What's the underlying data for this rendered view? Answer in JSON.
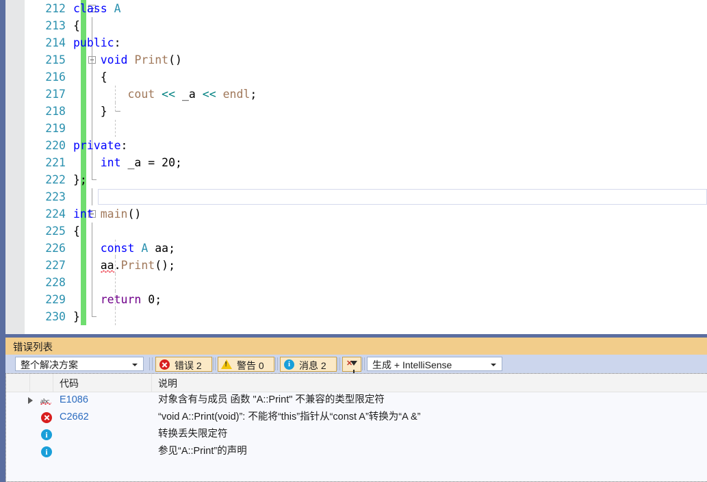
{
  "editor": {
    "lines": [
      {
        "num": "212",
        "indent": 0,
        "glyph": true,
        "text": "class A",
        "tokens": [
          {
            "t": "class",
            "c": "kw"
          },
          {
            "t": " ",
            "c": "idn"
          },
          {
            "t": "A",
            "c": "typ"
          }
        ]
      },
      {
        "num": "213",
        "indent": 0,
        "glyph": false,
        "text": "{",
        "tokens": [
          {
            "t": "{",
            "c": "idn"
          }
        ]
      },
      {
        "num": "214",
        "indent": 0,
        "glyph": false,
        "text": "public:",
        "tokens": [
          {
            "t": "public",
            "c": "kw"
          },
          {
            "t": ":",
            "c": "idn"
          }
        ]
      },
      {
        "num": "215",
        "indent": 0,
        "glyph": true,
        "text": "    void Print()",
        "tokens": [
          {
            "t": "    ",
            "c": "idn"
          },
          {
            "t": "void",
            "c": "kw"
          },
          {
            "t": " ",
            "c": "idn"
          },
          {
            "t": "Print",
            "c": "fn"
          },
          {
            "t": "()",
            "c": "idn"
          }
        ]
      },
      {
        "num": "216",
        "indent": 0,
        "glyph": false,
        "text": "    {",
        "tokens": [
          {
            "t": "    {",
            "c": "idn"
          }
        ]
      },
      {
        "num": "217",
        "indent": 0,
        "glyph": false,
        "text": "        cout << _a << endl;",
        "tokens": [
          {
            "t": "        ",
            "c": "idn"
          },
          {
            "t": "cout",
            "c": "fn"
          },
          {
            "t": " ",
            "c": "idn"
          },
          {
            "t": "<<",
            "c": "op"
          },
          {
            "t": " _a ",
            "c": "idn"
          },
          {
            "t": "<<",
            "c": "op"
          },
          {
            "t": " ",
            "c": "idn"
          },
          {
            "t": "endl",
            "c": "fn"
          },
          {
            "t": ";",
            "c": "idn"
          }
        ]
      },
      {
        "num": "218",
        "indent": 0,
        "glyph": false,
        "text": "    }",
        "tokens": [
          {
            "t": "    }",
            "c": "idn"
          }
        ]
      },
      {
        "num": "219",
        "indent": 0,
        "glyph": false,
        "text": "",
        "tokens": []
      },
      {
        "num": "220",
        "indent": 0,
        "glyph": false,
        "text": "private:",
        "tokens": [
          {
            "t": "private",
            "c": "kw"
          },
          {
            "t": ":",
            "c": "idn"
          }
        ]
      },
      {
        "num": "221",
        "indent": 0,
        "glyph": false,
        "text": "    int _a = 20;",
        "tokens": [
          {
            "t": "    ",
            "c": "idn"
          },
          {
            "t": "int",
            "c": "kw"
          },
          {
            "t": " _a = ",
            "c": "idn"
          },
          {
            "t": "20",
            "c": "num"
          },
          {
            "t": ";",
            "c": "idn"
          }
        ]
      },
      {
        "num": "222",
        "indent": 0,
        "glyph": false,
        "text": "};",
        "tokens": [
          {
            "t": "};",
            "c": "idn"
          }
        ]
      },
      {
        "num": "223",
        "indent": 0,
        "glyph": false,
        "text": "",
        "tokens": []
      },
      {
        "num": "224",
        "indent": 0,
        "glyph": true,
        "text": "int main()",
        "tokens": [
          {
            "t": "int",
            "c": "kw"
          },
          {
            "t": " ",
            "c": "idn"
          },
          {
            "t": "main",
            "c": "fn"
          },
          {
            "t": "()",
            "c": "idn"
          }
        ]
      },
      {
        "num": "225",
        "indent": 0,
        "glyph": false,
        "text": "{",
        "tokens": [
          {
            "t": "{",
            "c": "idn"
          }
        ]
      },
      {
        "num": "226",
        "indent": 0,
        "glyph": false,
        "text": "    const A aa;",
        "tokens": [
          {
            "t": "    ",
            "c": "idn"
          },
          {
            "t": "const",
            "c": "kw"
          },
          {
            "t": " ",
            "c": "idn"
          },
          {
            "t": "A",
            "c": "typ"
          },
          {
            "t": " aa;",
            "c": "idn"
          }
        ]
      },
      {
        "num": "227",
        "indent": 0,
        "glyph": false,
        "text": "    aa.Print();",
        "tokens": [
          {
            "t": "    ",
            "c": "idn"
          },
          {
            "t": "aa",
            "c": "idn",
            "squiggle": true
          },
          {
            "t": ".",
            "c": "idn"
          },
          {
            "t": "Print",
            "c": "fn"
          },
          {
            "t": "();",
            "c": "idn"
          }
        ]
      },
      {
        "num": "228",
        "indent": 0,
        "glyph": false,
        "text": "",
        "tokens": []
      },
      {
        "num": "229",
        "indent": 0,
        "glyph": false,
        "text": "    return 0;",
        "tokens": [
          {
            "t": "    ",
            "c": "idn"
          },
          {
            "t": "return",
            "c": "ppl"
          },
          {
            "t": " ",
            "c": "idn"
          },
          {
            "t": "0",
            "c": "num"
          },
          {
            "t": ";",
            "c": "idn"
          }
        ]
      },
      {
        "num": "230",
        "indent": 0,
        "glyph": false,
        "text": "}",
        "tokens": [
          {
            "t": "}",
            "c": "idn"
          }
        ]
      }
    ],
    "current_line_index": 11
  },
  "error_panel": {
    "title": "错误列表",
    "scope_filter": {
      "value": "整个解决方案"
    },
    "source_filter": {
      "value": "生成 + IntelliSense"
    },
    "buttons": [
      {
        "name": "errors",
        "label": "错误 2",
        "icon": "error-circle-icon"
      },
      {
        "name": "warnings",
        "label": "警告 0",
        "icon": "warning-triangle-icon"
      },
      {
        "name": "messages",
        "label": "消息 2",
        "icon": "info-circle-icon"
      }
    ],
    "clear_filter_icon": "clear-filter-icon",
    "columns": [
      "代码",
      "说明"
    ],
    "rows": [
      {
        "expander": true,
        "icon": "intellisense-abc-icon",
        "code": "E1086",
        "description": "对象含有与成员 函数 \"A::Print\" 不兼容的类型限定符"
      },
      {
        "expander": false,
        "icon": "error-circle-icon",
        "code": "C2662",
        "description": "“void A::Print(void)”: 不能将“this”指针从“const A”转换为“A &”"
      },
      {
        "expander": false,
        "icon": "info-circle-icon",
        "code": "",
        "description": "转换丢失限定符"
      },
      {
        "expander": false,
        "icon": "info-circle-icon",
        "code": "",
        "description": "参见“A::Print”的声明"
      }
    ]
  },
  "colors": {
    "indicator_strip": "#5b6ea0",
    "change_bar": "#6fdd6f",
    "panel_title_bg": "#f2cd8b",
    "panel_toolbar_bg": "#ccd6ed",
    "line_number": "#2b91af",
    "keyword": "#0000ff",
    "type": "#2b91af",
    "function": "#a0785a",
    "operator": "#008080",
    "control_keyword": "#6f008a",
    "error_red": "#d81e1e",
    "warning_yellow": "#f2c40c",
    "info_blue": "#1a9fd9",
    "code_link": "#2b6bbf"
  }
}
